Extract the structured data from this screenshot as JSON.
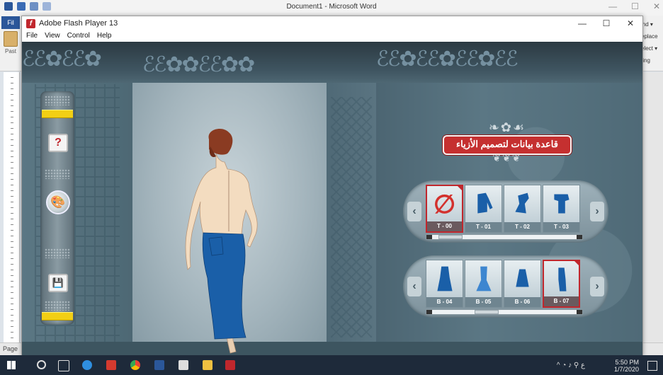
{
  "word": {
    "doc_title": "Document1 - Microsoft Word",
    "file_tab": "Fil",
    "paste": "Past",
    "ribbon_right": [
      "ind ▾",
      "eplace",
      "elect ▾",
      "ting"
    ],
    "status_page": "Page"
  },
  "flash": {
    "app_title": "Adobe Flash Player 13",
    "menu": [
      "File",
      "View",
      "Control",
      "Help"
    ],
    "min": "—",
    "max": "☐",
    "close": "✕"
  },
  "toolbar": {
    "help_label": "?",
    "palette_glyph": "🎨",
    "save_glyph": "💾"
  },
  "title_plaque": {
    "text": "قاعدة بيانات لتصميم الأزياء"
  },
  "tops_selector": {
    "items": [
      {
        "label": "T - 00",
        "icon": "none-icon",
        "selected": true
      },
      {
        "label": "T - 01",
        "icon": "long-sleeve-top-icon",
        "selected": false
      },
      {
        "label": "T - 02",
        "icon": "asymmetric-top-icon",
        "selected": false
      },
      {
        "label": "T - 03",
        "icon": "short-sleeve-top-icon",
        "selected": false
      }
    ],
    "scroll_position": 0.05
  },
  "bottoms_selector": {
    "items": [
      {
        "label": "B - 04",
        "icon": "flared-skirt-icon",
        "selected": false
      },
      {
        "label": "B - 05",
        "icon": "mermaid-skirt-icon",
        "selected": false
      },
      {
        "label": "B - 06",
        "icon": "a-line-skirt-icon",
        "selected": false
      },
      {
        "label": "B - 07",
        "icon": "pencil-skirt-icon",
        "selected": true
      }
    ],
    "scroll_position": 0.35
  },
  "taskbar": {
    "time": "5:50 PM",
    "date": "1/7/2020",
    "lang": "ع"
  },
  "colors": {
    "accent_red": "#c0272d",
    "garment_blue": "#1a5fa8",
    "toolbar_yellow": "#f2cf14"
  }
}
